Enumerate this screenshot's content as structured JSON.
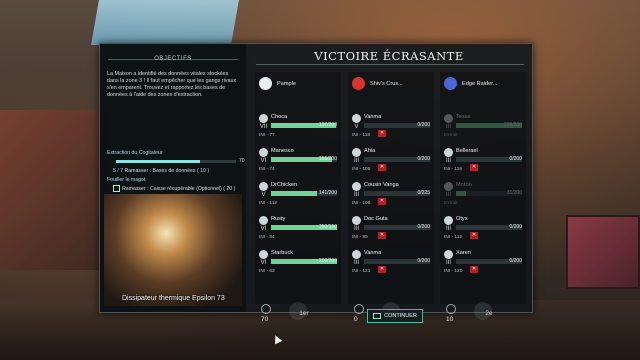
{
  "objectives": {
    "title": "OBJECTIFS",
    "description": "La Maison a identifié des données vitales stockées dans la zone 3 ! Il faut empêcher que les gangs rivaux s'en emparent. Trouvez et rapportez les bases de données à l'aide des zones d'extraction.",
    "section1": "Extraction du Cogitateur",
    "bar_value": "70",
    "bar_percent": 70,
    "line1": "5 / 7  Ramasser : Bases de données",
    "line1_reward": "( 10 )",
    "section2": "Fouiller le magot",
    "line2": "Ramasser : Caisse récupérable (Optionnel)",
    "line2_reward": "( 20 )",
    "image_caption": "Dissipateur thermique Epsilon 73"
  },
  "title": "VICTOIRE ÉCRASANTE",
  "teams": [
    {
      "name": "Pample",
      "emblem_color": "#e8eef0",
      "bar_color": "#6fd39a",
      "members": [
        {
          "rank": "VII",
          "name": "Choca",
          "hp": "197/200",
          "ini": "INI - 77",
          "fill": 0.98
        },
        {
          "rank": "VI",
          "name": "Manesco",
          "hp": "186/200",
          "ini": "INI - 74",
          "fill": 0.93
        },
        {
          "rank": "V",
          "name": "DrChicken",
          "hp": "141/200",
          "ini": "INI - 112",
          "fill": 0.7
        },
        {
          "rank": "VI",
          "name": "Rusty",
          "hp": "150/150",
          "ini": "INI - 84",
          "fill": 1.0
        },
        {
          "rank": "VI",
          "name": "Starbuck",
          "hp": "200/200",
          "ini": "INI - 63",
          "fill": 1.0
        }
      ],
      "score": "70",
      "place": "1er"
    },
    {
      "name": "Shiv's Crus...",
      "emblem_color": "#d8332e",
      "bar_color": "#6fd39a",
      "members": [
        {
          "rank": "V",
          "name": "Vanma",
          "hp": "0/200",
          "ini": "INI - 118",
          "fill": 0
        },
        {
          "rank": "III",
          "name": "Ahia",
          "hp": "0/200",
          "ini": "INI - 108",
          "fill": 0
        },
        {
          "rank": "III",
          "name": "Cousin Vanga",
          "hp": "0/225",
          "ini": "INI - 106",
          "fill": 0
        },
        {
          "rank": "III",
          "name": "Doc Guta",
          "hp": "0/200",
          "ini": "INI - 89",
          "fill": 0
        },
        {
          "rank": "III",
          "name": "Vanma",
          "hp": "0/200",
          "ini": "INI - 121",
          "fill": 0
        }
      ],
      "score": "0",
      "place": "Échec"
    },
    {
      "name": "Edge Raider...",
      "emblem_color": "#4c66d8",
      "bar_color": "#6fd39a",
      "members": [
        {
          "rank": "III",
          "name": "Texas",
          "hp": "200/200",
          "ini": "Extrait",
          "fill": 1.0,
          "faded": true
        },
        {
          "rank": "III",
          "name": "Bellerael",
          "hp": "0/200",
          "ini": "INI - 116",
          "fill": 0
        },
        {
          "rank": "III",
          "name": "Moron",
          "hp": "31/200",
          "ini": "Extrait",
          "fill": 0.15,
          "faded": true
        },
        {
          "rank": "III",
          "name": "Otyx",
          "hp": "0/200",
          "ini": "INI - 112",
          "fill": 0
        },
        {
          "rank": "III",
          "name": "Xaren",
          "hp": "0/200",
          "ini": "INI - 120",
          "fill": 0
        }
      ],
      "score": "10",
      "place": "2e"
    }
  ],
  "continue_label": "CONTINUER"
}
